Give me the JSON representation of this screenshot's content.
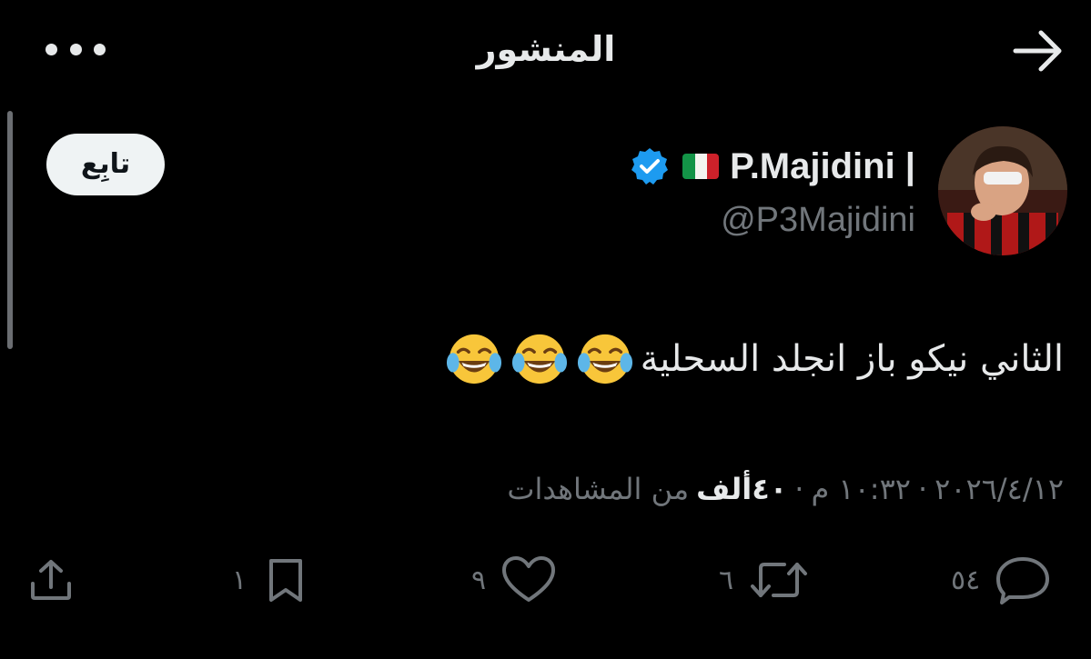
{
  "header": {
    "title": "المنشور",
    "more_icon": "more-horizontal-icon",
    "back_icon": "arrow-right-icon"
  },
  "author": {
    "display_name": "P.Majidini |",
    "handle": "@P3Majidini",
    "verified": true,
    "flag": "italy-flag",
    "follow_label": "تابِع"
  },
  "tweet": {
    "text": "الثاني نيكو باز انجلد السحلية",
    "emoji": [
      "face-with-tears-of-joy",
      "face-with-tears-of-joy",
      "face-with-tears-of-joy"
    ]
  },
  "meta": {
    "date": "٢٠٢٦/٤/١٢",
    "separator": "·",
    "time": "١٠:٣٢ م",
    "views_count": "٤٠ألف",
    "views_label": "من المشاهدات"
  },
  "actions": {
    "replies": "٥٤",
    "reposts": "٦",
    "likes": "٩",
    "bookmarks": "١"
  },
  "colors": {
    "background": "#000000",
    "text_primary": "#e7e9ea",
    "text_secondary": "#71767b",
    "verified_blue": "#1d9bf0",
    "follow_button_bg": "#eff3f4"
  }
}
